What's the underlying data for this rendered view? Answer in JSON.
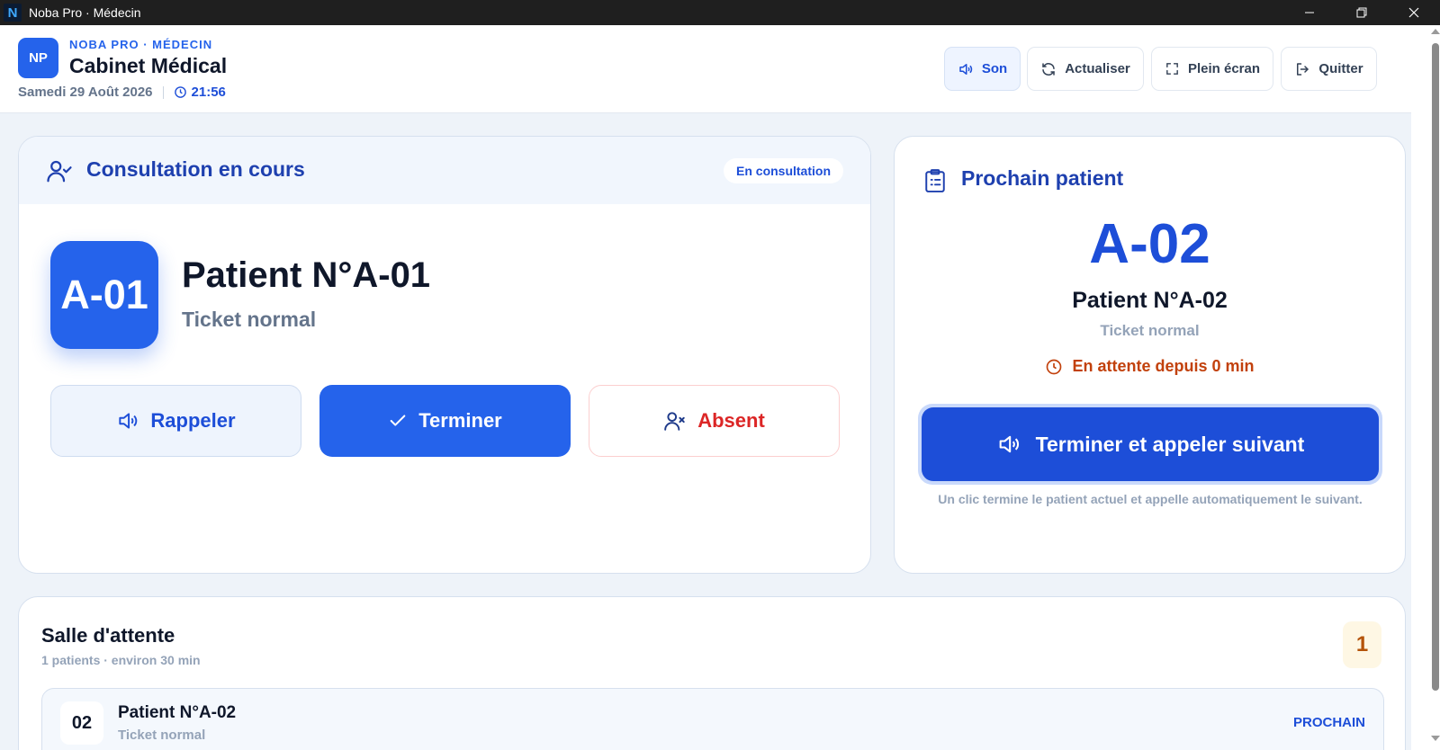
{
  "window": {
    "title": "Noba Pro · Médecin",
    "logo_letter": "N"
  },
  "header": {
    "logo_initials": "NP",
    "brand_sub": "NOBA PRO · MÉDECIN",
    "brand_title": "Cabinet Médical",
    "date": "Samedi 29 Août 2026",
    "time": "21:56",
    "buttons": {
      "sound": "Son",
      "refresh": "Actualiser",
      "fullscreen": "Plein écran",
      "quit": "Quitter"
    }
  },
  "current": {
    "title": "Consultation en cours",
    "status": "En consultation",
    "ticket": "A-01",
    "patient_name": "Patient N°A-01",
    "ticket_type": "Ticket normal",
    "actions": {
      "recall": "Rappeler",
      "finish": "Terminer",
      "absent": "Absent"
    }
  },
  "next": {
    "title": "Prochain patient",
    "ticket": "A-02",
    "patient_name": "Patient N°A-02",
    "ticket_type": "Ticket normal",
    "waiting": "En attente depuis 0 min",
    "call_button": "Terminer et appeler suivant",
    "hint": "Un clic termine le patient actuel et appelle automatiquement le suivant."
  },
  "waiting_room": {
    "title": "Salle d'attente",
    "subtitle": "1 patients · environ 30 min",
    "count": "1",
    "rows": [
      {
        "number": "02",
        "name": "Patient N°A-02",
        "type": "Ticket normal",
        "tag": "PROCHAIN"
      }
    ]
  },
  "colors": {
    "primary": "#2563eb",
    "primary_dark": "#1d4ed8",
    "danger": "#dc2626",
    "warning": "#c2410c"
  }
}
